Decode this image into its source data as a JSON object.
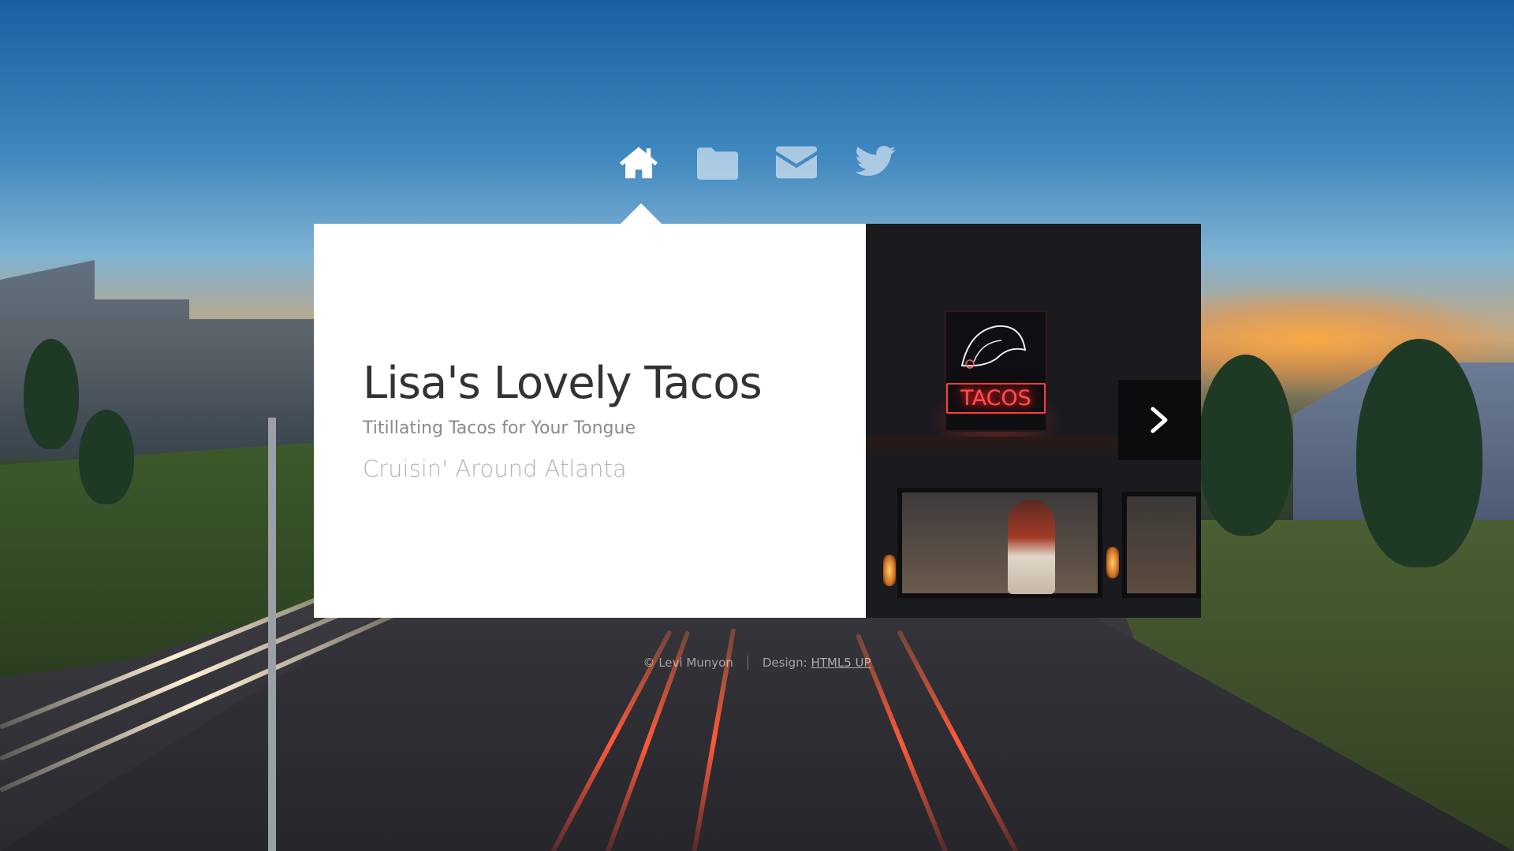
{
  "nav": {
    "items": [
      {
        "icon": "home-icon",
        "active": true
      },
      {
        "icon": "folder-icon",
        "active": false
      },
      {
        "icon": "envelope-icon",
        "active": false
      },
      {
        "icon": "twitter-icon",
        "active": false
      }
    ]
  },
  "intro": {
    "title": "Lisa's Lovely Tacos",
    "subtitle": "Titillating Tacos for Your Tongue",
    "tagline": "Cruisin' Around Atlanta"
  },
  "image": {
    "neon_text": "TACOS",
    "next_icon": "chevron-right-icon"
  },
  "footer": {
    "copyright": "© Levi Munyon",
    "design_label": "Design: ",
    "design_link": "HTML5 UP"
  },
  "colors": {
    "panel_bg": "#ffffff",
    "title": "#333333",
    "subtitle": "#8a8a8a",
    "tagline": "#b3b3b3",
    "next_button_bg": "#0c0c0e"
  }
}
